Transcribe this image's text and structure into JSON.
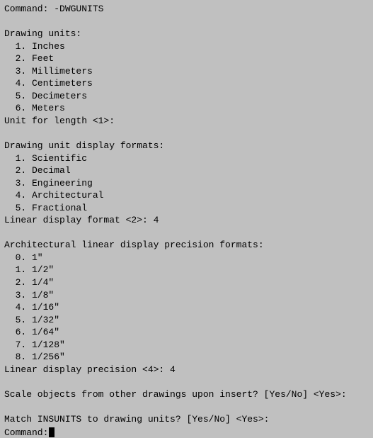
{
  "terminal": {
    "background": "#c0c0c0",
    "text_color": "#000000",
    "content": [
      "Command: -DWGUNITS",
      "",
      "Drawing units:",
      "  1. Inches",
      "  2. Feet",
      "  3. Millimeters",
      "  4. Centimeters",
      "  5. Decimeters",
      "  6. Meters",
      "Unit for length <1>:",
      "",
      "Drawing unit display formats:",
      "  1. Scientific",
      "  2. Decimal",
      "  3. Engineering",
      "  4. Architectural",
      "  5. Fractional",
      "Linear display format <2>: 4",
      "",
      "Architectural linear display precision formats:",
      "  0. 1\"",
      "  1. 1/2\"",
      "  2. 1/4\"",
      "  3. 1/8\"",
      "  4. 1/16\"",
      "  5. 1/32\"",
      "  6. 1/64\"",
      "  7. 1/128\"",
      "  8. 1/256\"",
      "Linear display precision <4>: 4",
      "",
      "Scale objects from other drawings upon insert? [Yes/No] <Yes>:",
      "",
      "Match INSUNITS to drawing units? [Yes/No] <Yes>:",
      ""
    ],
    "command_prompt": "Command: "
  }
}
